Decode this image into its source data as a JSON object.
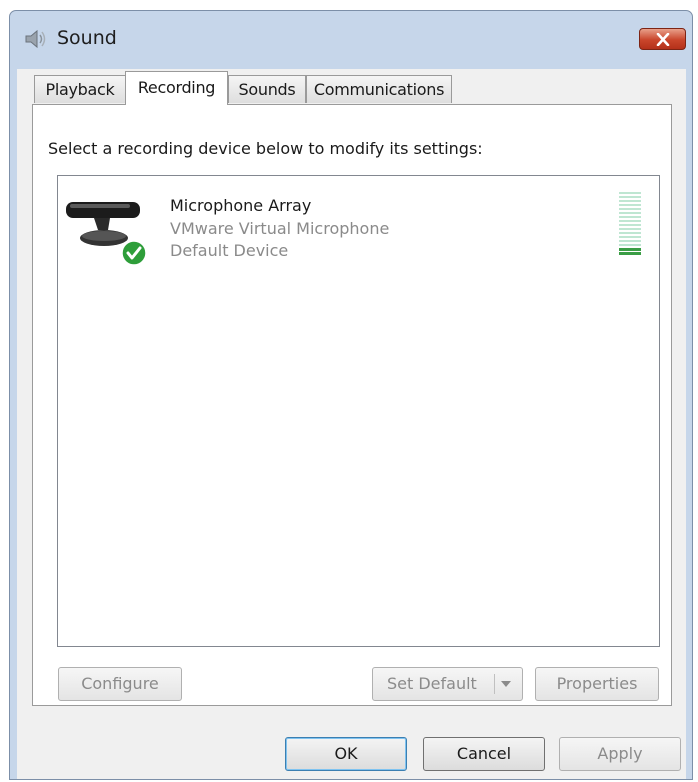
{
  "window": {
    "title": "Sound"
  },
  "tabs": [
    {
      "label": "Playback"
    },
    {
      "label": "Recording"
    },
    {
      "label": "Sounds"
    },
    {
      "label": "Communications"
    }
  ],
  "active_tab": "Recording",
  "instruction": "Select a recording device below to modify its settings:",
  "devices": [
    {
      "name": "Microphone Array",
      "description": "VMware Virtual Microphone",
      "status": "Default Device",
      "icon": "microphone-array-icon",
      "badge": "default-check-icon",
      "level": 0.1
    }
  ],
  "panel_buttons": {
    "configure": "Configure",
    "set_default": "Set Default",
    "properties": "Properties"
  },
  "dialog_buttons": {
    "ok": "OK",
    "cancel": "Cancel",
    "apply": "Apply"
  },
  "colors": {
    "close_button": "#c9452b",
    "level_active": "#3a9d45",
    "level_inactive": "#bfe6d2",
    "default_check": "#2e9e3a"
  }
}
